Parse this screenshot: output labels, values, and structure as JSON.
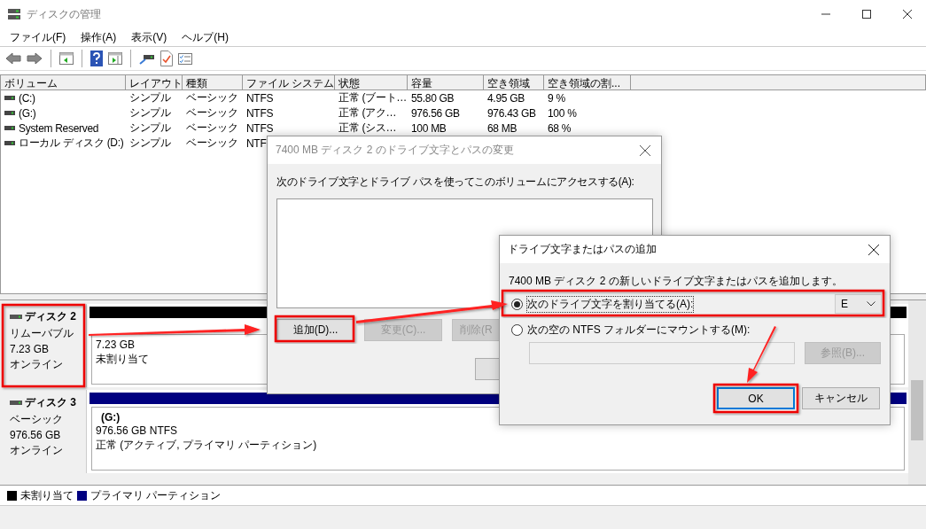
{
  "window": {
    "title": "ディスクの管理"
  },
  "menu": [
    "ファイル(F)",
    "操作(A)",
    "表示(V)",
    "ヘルプ(H)"
  ],
  "volumes": {
    "columns": [
      "ボリューム",
      "レイアウト",
      "種類",
      "ファイル システム",
      "状態",
      "容量",
      "空き領域",
      "空き領域の割..."
    ],
    "rows": [
      {
        "cells": [
          "(C:)",
          "シンプル",
          "ベーシック",
          "NTFS",
          "正常 (ブート…",
          "55.80 GB",
          "4.95 GB",
          "9 %"
        ]
      },
      {
        "cells": [
          "(G:)",
          "シンプル",
          "ベーシック",
          "NTFS",
          "正常 (アク…",
          "976.56 GB",
          "976.43 GB",
          "100 %"
        ]
      },
      {
        "cells": [
          "System Reserved",
          "シンプル",
          "ベーシック",
          "NTFS",
          "正常 (シス…",
          "100 MB",
          "68 MB",
          "68 %"
        ]
      },
      {
        "cells": [
          "ローカル ディスク (D:)",
          "シンプル",
          "ベーシック",
          "NTF"
        ]
      }
    ]
  },
  "disks": [
    {
      "name": "ディスク 2",
      "type": "リムーバブル",
      "size": "7.23 GB",
      "status": "オンライン",
      "partitions": [
        {
          "kind": "unallocated",
          "color": "#000000",
          "lines": [
            "7.23 GB",
            "未割り当て"
          ]
        }
      ]
    },
    {
      "name": "ディスク 3",
      "type": "ベーシック",
      "size": "976.56 GB",
      "status": "オンライン",
      "partitions": [
        {
          "kind": "primary",
          "color": "#000080",
          "label": "(G:)",
          "lines": [
            "976.56 GB NTFS",
            "正常 (アクティブ, プライマリ パーティション)"
          ]
        }
      ]
    }
  ],
  "legend": [
    {
      "label": "未割り当て",
      "color": "#000000"
    },
    {
      "label": "プライマリ パーティション",
      "color": "#000080"
    }
  ],
  "dialog1": {
    "title": "7400 MB  ディスク 2 のドライブ文字とパスの変更",
    "prompt": "次のドライブ文字とドライブ パスを使ってこのボリュームにアクセスする(A):",
    "buttons": [
      {
        "label": "追加(D)...",
        "disabled": false
      },
      {
        "label": "変更(C)...",
        "disabled": true
      },
      {
        "label": "削除(R",
        "disabled": true
      }
    ]
  },
  "dialog2": {
    "title": "ドライブ文字またはパスの追加",
    "description": "7400 MB  ディスク 2 の新しいドライブ文字またはパスを追加します。",
    "options": [
      {
        "kind": "letter",
        "label": "次のドライブ文字を割り当てる(A):",
        "selected": true,
        "value": "E"
      },
      {
        "kind": "folder",
        "label": "次の空の NTFS フォルダーにマウントする(M):",
        "selected": false,
        "browse": {
          "label": "参照(B)...",
          "disabled": true
        }
      }
    ],
    "buttons": [
      {
        "label": "OK",
        "default": true
      },
      {
        "label": "キャンセル",
        "default": false
      }
    ]
  }
}
